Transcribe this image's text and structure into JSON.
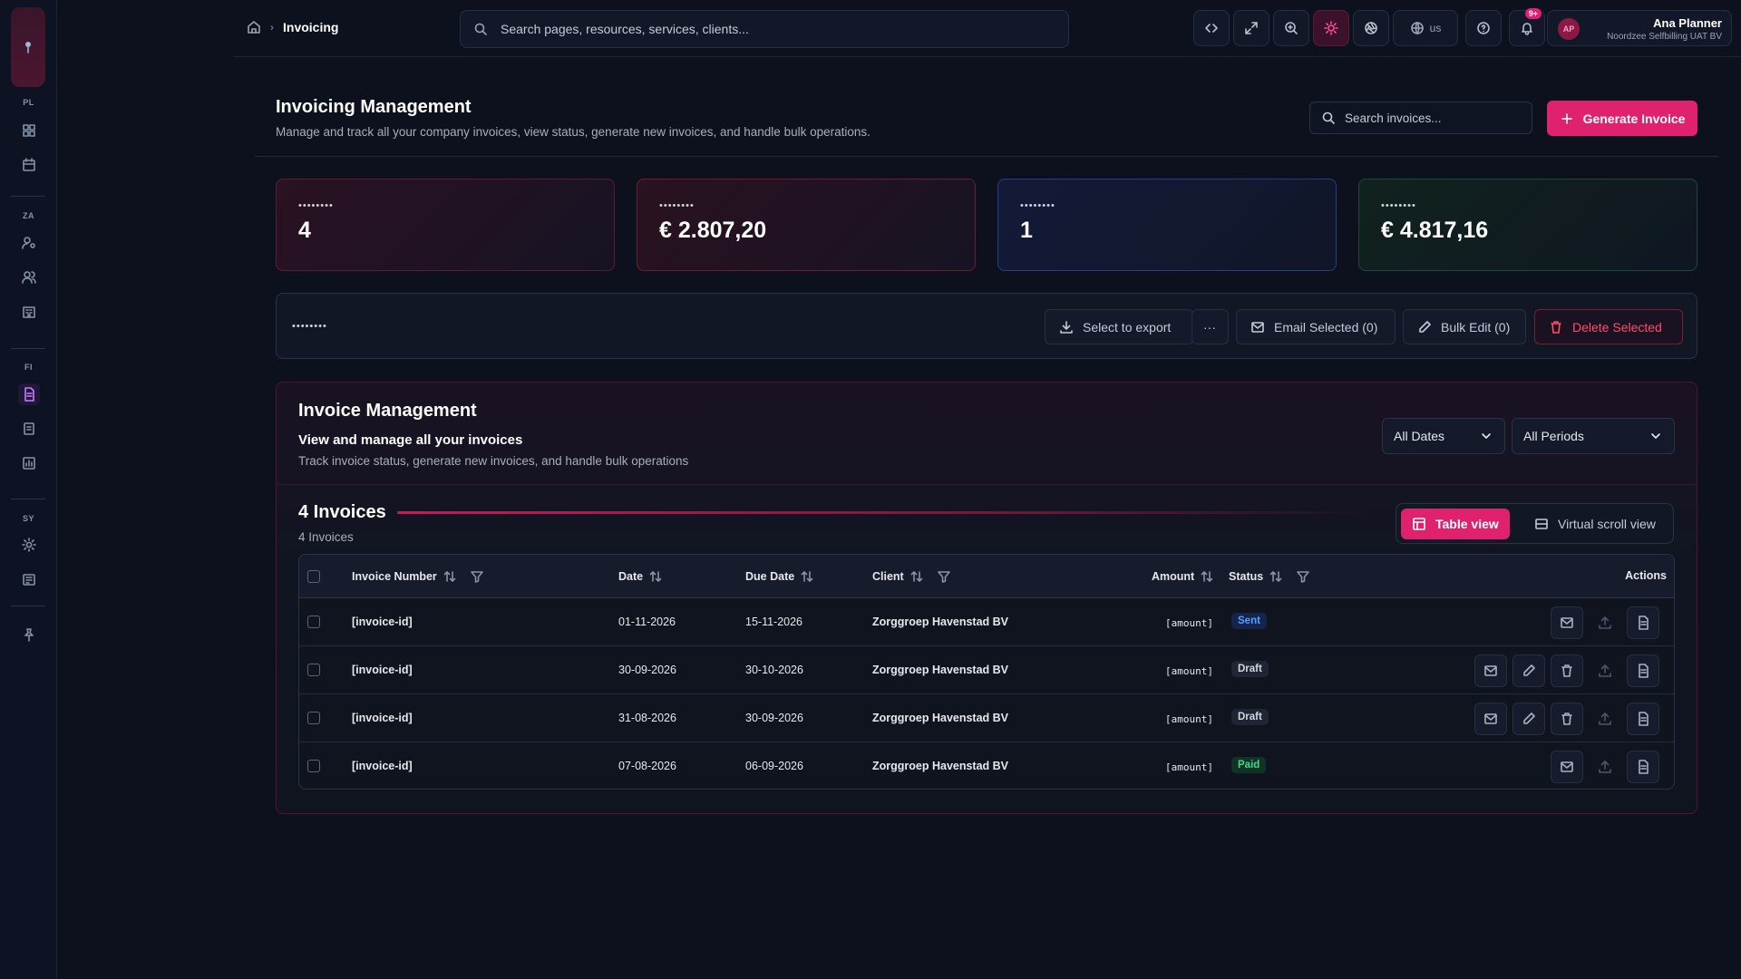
{
  "header": {
    "breadcrumb": "Invoicing",
    "search_placeholder": "Search pages, resources, services, clients...",
    "lang": "us",
    "notif_count": "9+",
    "user_initials": "AP",
    "user_name": "Ana Planner",
    "user_org": "Noordzee Selfbilling UAT BV"
  },
  "sidebar": {
    "sections": [
      "PL",
      "ZA",
      "FI",
      "SY"
    ]
  },
  "page": {
    "title": "Invoicing Management",
    "subtitle": "Manage and track all your company invoices, view status, generate new invoices, and handle bulk operations.",
    "search_placeholder": "Search invoices...",
    "generate_label": "Generate Invoice"
  },
  "stats": [
    {
      "label": "••••••••",
      "value": "4"
    },
    {
      "label": "••••••••",
      "value": "€ 2.807,20"
    },
    {
      "label": "••••••••",
      "value": "1"
    },
    {
      "label": "••••••••",
      "value": "€ 4.817,16"
    }
  ],
  "bulk": {
    "label": "••••••••",
    "export_label": "Select to export",
    "more_label": "···",
    "email_label": "Email Selected (0)",
    "edit_label": "Bulk Edit (0)",
    "delete_label": "Delete Selected"
  },
  "panel": {
    "title": "Invoice Management",
    "subtitle": "View and manage all your invoices",
    "description": "Track invoice status, generate new invoices, and handle bulk operations",
    "dates_select": "All Dates",
    "periods_select": "All Periods",
    "count_title": "4 Invoices",
    "count_sub": "4 Invoices",
    "table_view": "Table view",
    "virtual_view": "Virtual scroll view"
  },
  "table": {
    "columns": {
      "invoice_number": "Invoice Number",
      "date": "Date",
      "due_date": "Due Date",
      "client": "Client",
      "amount": "Amount",
      "status": "Status",
      "actions": "Actions"
    },
    "rows": [
      {
        "invoice": "[invoice-id]",
        "date": "01-11-2026",
        "due": "15-11-2026",
        "client": "Zorggroep Havenstad BV",
        "amount": "[amount]",
        "status": "Sent"
      },
      {
        "invoice": "[invoice-id]",
        "date": "30-09-2026",
        "due": "30-10-2026",
        "client": "Zorggroep Havenstad BV",
        "amount": "[amount]",
        "status": "Draft"
      },
      {
        "invoice": "[invoice-id]",
        "date": "31-08-2026",
        "due": "30-09-2026",
        "client": "Zorggroep Havenstad BV",
        "amount": "[amount]",
        "status": "Draft"
      },
      {
        "invoice": "[invoice-id]",
        "date": "07-08-2026",
        "due": "06-09-2026",
        "client": "Zorggroep Havenstad BV",
        "amount": "[amount]",
        "status": "Paid"
      }
    ]
  },
  "colors": {
    "accent": "#e0226e",
    "background": "#0c111d",
    "status_sent": "#5b9dff",
    "status_paid": "#3ddc84"
  }
}
